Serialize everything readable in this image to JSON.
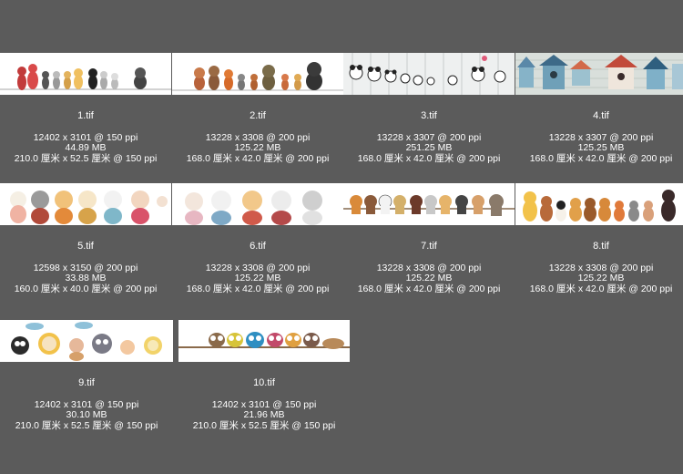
{
  "items": [
    {
      "name": "1.tif",
      "dims": "12402 x 3101 @ 150 ppi",
      "size": "44.89 MB",
      "physical": "210.0 厘米 x 52.5 厘米 @ 150 ppi",
      "thumb": "cats-line"
    },
    {
      "name": "2.tif",
      "dims": "13228 x 3308 @ 200 ppi",
      "size": "125.22 MB",
      "physical": "168.0 厘米 x 42.0 厘米 @ 200 ppi",
      "thumb": "forest-animals"
    },
    {
      "name": "3.tif",
      "dims": "13228 x 3307 @ 200 ppi",
      "size": "251.25 MB",
      "physical": "168.0 厘米 x 42.0 厘米 @ 200 ppi",
      "thumb": "pandas-fence"
    },
    {
      "name": "4.tif",
      "dims": "13228 x 3307 @ 200 ppi",
      "size": "125.25 MB",
      "physical": "168.0 厘米 x 42.0 厘米 @ 200 ppi",
      "thumb": "birdhouses"
    },
    {
      "name": "5.tif",
      "dims": "12598 x 3150 @ 200 ppi",
      "size": "33.88 MB",
      "physical": "160.0 厘米 x 40.0 厘米 @ 200 ppi",
      "thumb": "lucky-cats"
    },
    {
      "name": "6.tif",
      "dims": "13228 x 3308 @ 200 ppi",
      "size": "125.22 MB",
      "physical": "168.0 厘米 x 42.0 厘米 @ 200 ppi",
      "thumb": "cats-portraits"
    },
    {
      "name": "7.tif",
      "dims": "13228 x 3308 @ 200 ppi",
      "size": "125.22 MB",
      "physical": "168.0 厘米 x 42.0 厘米 @ 200 ppi",
      "thumb": "dogs-rope"
    },
    {
      "name": "8.tif",
      "dims": "13228 x 3308 @ 200 ppi",
      "size": "125.22 MB",
      "physical": "168.0 厘米 x 42.0 厘米 @ 200 ppi",
      "thumb": "dogs-lineup"
    },
    {
      "name": "9.tif",
      "dims": "12402 x 3101 @ 150 ppi",
      "size": "30.10 MB",
      "physical": "210.0 厘米 x 52.5 厘米 @ 150 ppi",
      "thumb": "cartoon-cats-sky"
    },
    {
      "name": "10.tif",
      "dims": "12402 x 3101 @ 150 ppi",
      "size": "21.96 MB",
      "physical": "210.0 厘米 x 52.5 厘米 @ 150 ppi",
      "thumb": "owls-branch"
    }
  ]
}
